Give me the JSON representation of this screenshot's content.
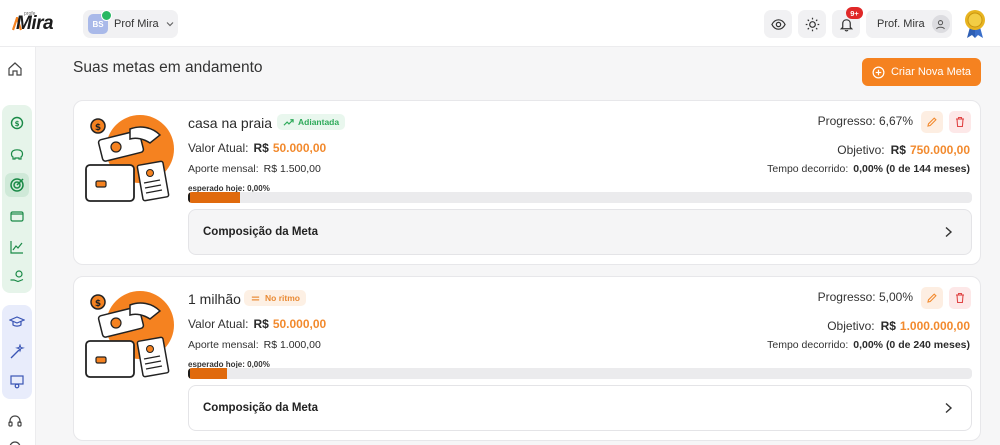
{
  "app": {
    "logo_text": "Mira",
    "logo_small": "profe"
  },
  "header": {
    "profile_initials": "BS",
    "profile_name": "Prof Mira",
    "notif_badge": "9+",
    "user_name": "Prof. Mira"
  },
  "main": {
    "title": "Suas metas em andamento",
    "new_goal_label": "Criar Nova Meta"
  },
  "goals": [
    {
      "name": "casa na praia",
      "status": "Adiantada",
      "status_color": "#2eaa5a",
      "valor_label": "Valor Atual:",
      "valor_currency": "R$",
      "valor_value": "50.000,00",
      "aporte_label": "Aporte mensal:",
      "aporte_value": "R$  1.500,00",
      "esperado": "esperado hoje: 0,00%",
      "progress_text": "Progresso: 6,67%",
      "progress_fraction": 0.0667,
      "objetivo_label": "Objetivo:",
      "objetivo_currency": "R$",
      "objetivo_value": "750.000,00",
      "tempo_label": "Tempo decorrido:",
      "tempo_value": "0,00% (0 de 144 meses)",
      "composicao_label": "Composição da Meta"
    },
    {
      "name": "1 milhão",
      "status": "No ritmo",
      "status_color": "#e98a34",
      "valor_label": "Valor Atual:",
      "valor_currency": "R$",
      "valor_value": "50.000,00",
      "aporte_label": "Aporte mensal:",
      "aporte_value": "R$  1.000,00",
      "esperado": "esperado hoje: 0,00%",
      "progress_text": "Progresso: 5,00%",
      "progress_fraction": 0.05,
      "objetivo_label": "Objetivo:",
      "objetivo_currency": "R$",
      "objetivo_value": "1.000.000,00",
      "tempo_label": "Tempo decorrido:",
      "tempo_value": "0,00% (0 de 240 meses)",
      "composicao_label": "Composição da Meta"
    }
  ],
  "colors": {
    "accent": "#f58220",
    "progress_fill": "#e06a0d",
    "sidebar_group_green": "#e6f4ea",
    "sidebar_group_blue": "#e8ecfb"
  },
  "icons": {
    "sidebar": [
      "home-icon",
      "money-cycle-icon",
      "piggy-bank-icon",
      "target-icon",
      "wallet-icon",
      "chart-line-icon",
      "hand-coins-icon",
      "graduation-cap-icon",
      "sparkle-wand-icon",
      "teacher-icon",
      "headset-icon",
      "settings-icon"
    ],
    "header": [
      "eye-icon",
      "sun-icon",
      "bell-icon",
      "user-icon",
      "medal-icon"
    ]
  }
}
